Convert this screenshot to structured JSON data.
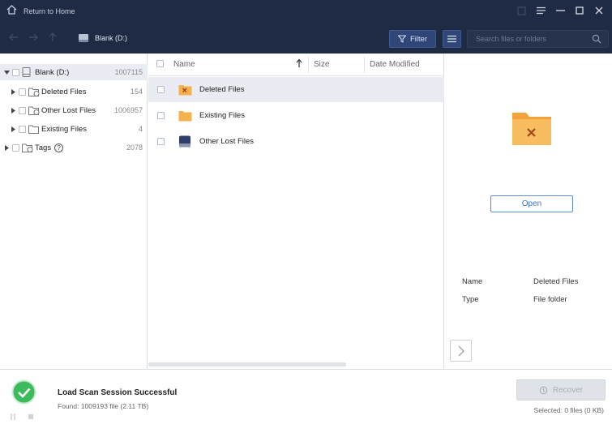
{
  "titlebar": {
    "home_label": "Return to Home"
  },
  "navbar": {
    "drive_label": "Blank (D:)",
    "filter_label": "Filter",
    "search_placeholder": "Search files or folders"
  },
  "tree": {
    "items": [
      {
        "label": "Blank (D:)",
        "count": "1007115"
      },
      {
        "label": "Deleted Files",
        "count": "154"
      },
      {
        "label": "Other Lost Files",
        "count": "1006957"
      },
      {
        "label": "Existing Files",
        "count": "4"
      },
      {
        "label": "Tags",
        "count": "2078"
      }
    ]
  },
  "filelist": {
    "columns": {
      "name": "Name",
      "size": "Size",
      "date": "Date Modified"
    },
    "rows": [
      {
        "name": "Deleted Files"
      },
      {
        "name": "Existing Files"
      },
      {
        "name": "Other Lost Files"
      }
    ]
  },
  "preview": {
    "open_label": "Open",
    "name_label": "Name",
    "name_value": "Deleted Files",
    "type_label": "Type",
    "type_value": "File folder"
  },
  "status": {
    "title": "Load Scan Session Successful",
    "found": "Found: 1009193 file (2.11 TB)",
    "recover_label": "Recover",
    "selected_info": "Selected: 0 files (0 KB)"
  },
  "colors": {
    "titlebar_bg": "#1f2a44",
    "accent_blue": "#3d74c2",
    "folder_orange": "#f5b14c",
    "success_green": "#3dba5b"
  }
}
